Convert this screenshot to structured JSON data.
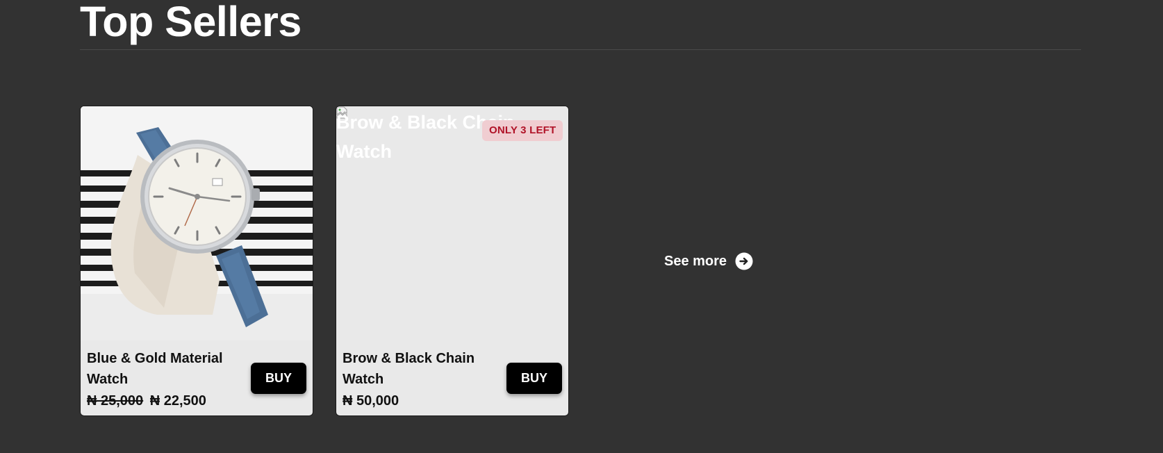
{
  "section": {
    "title": "Top Sellers"
  },
  "products": [
    {
      "name": "Blue & Gold Material Watch",
      "old_price": "₦ 25,000",
      "price": "₦ 22,500",
      "buy_label": "BUY",
      "image": "watch-photo"
    },
    {
      "name": "Brow & Black Chain Watch",
      "image_alt": "Brow & Black Chain Watch",
      "badge": "ONLY 3 LEFT",
      "price": "₦ 50,000",
      "buy_label": "BUY",
      "image": "broken-image-icon"
    }
  ],
  "see_more": {
    "label": "See more",
    "icon": "arrow-right-circle-icon"
  },
  "colors": {
    "background": "#323232",
    "card": "#e9e9e9",
    "button": "#000000",
    "badge_bg": "#f0cdd1",
    "badge_text": "#b01227"
  }
}
